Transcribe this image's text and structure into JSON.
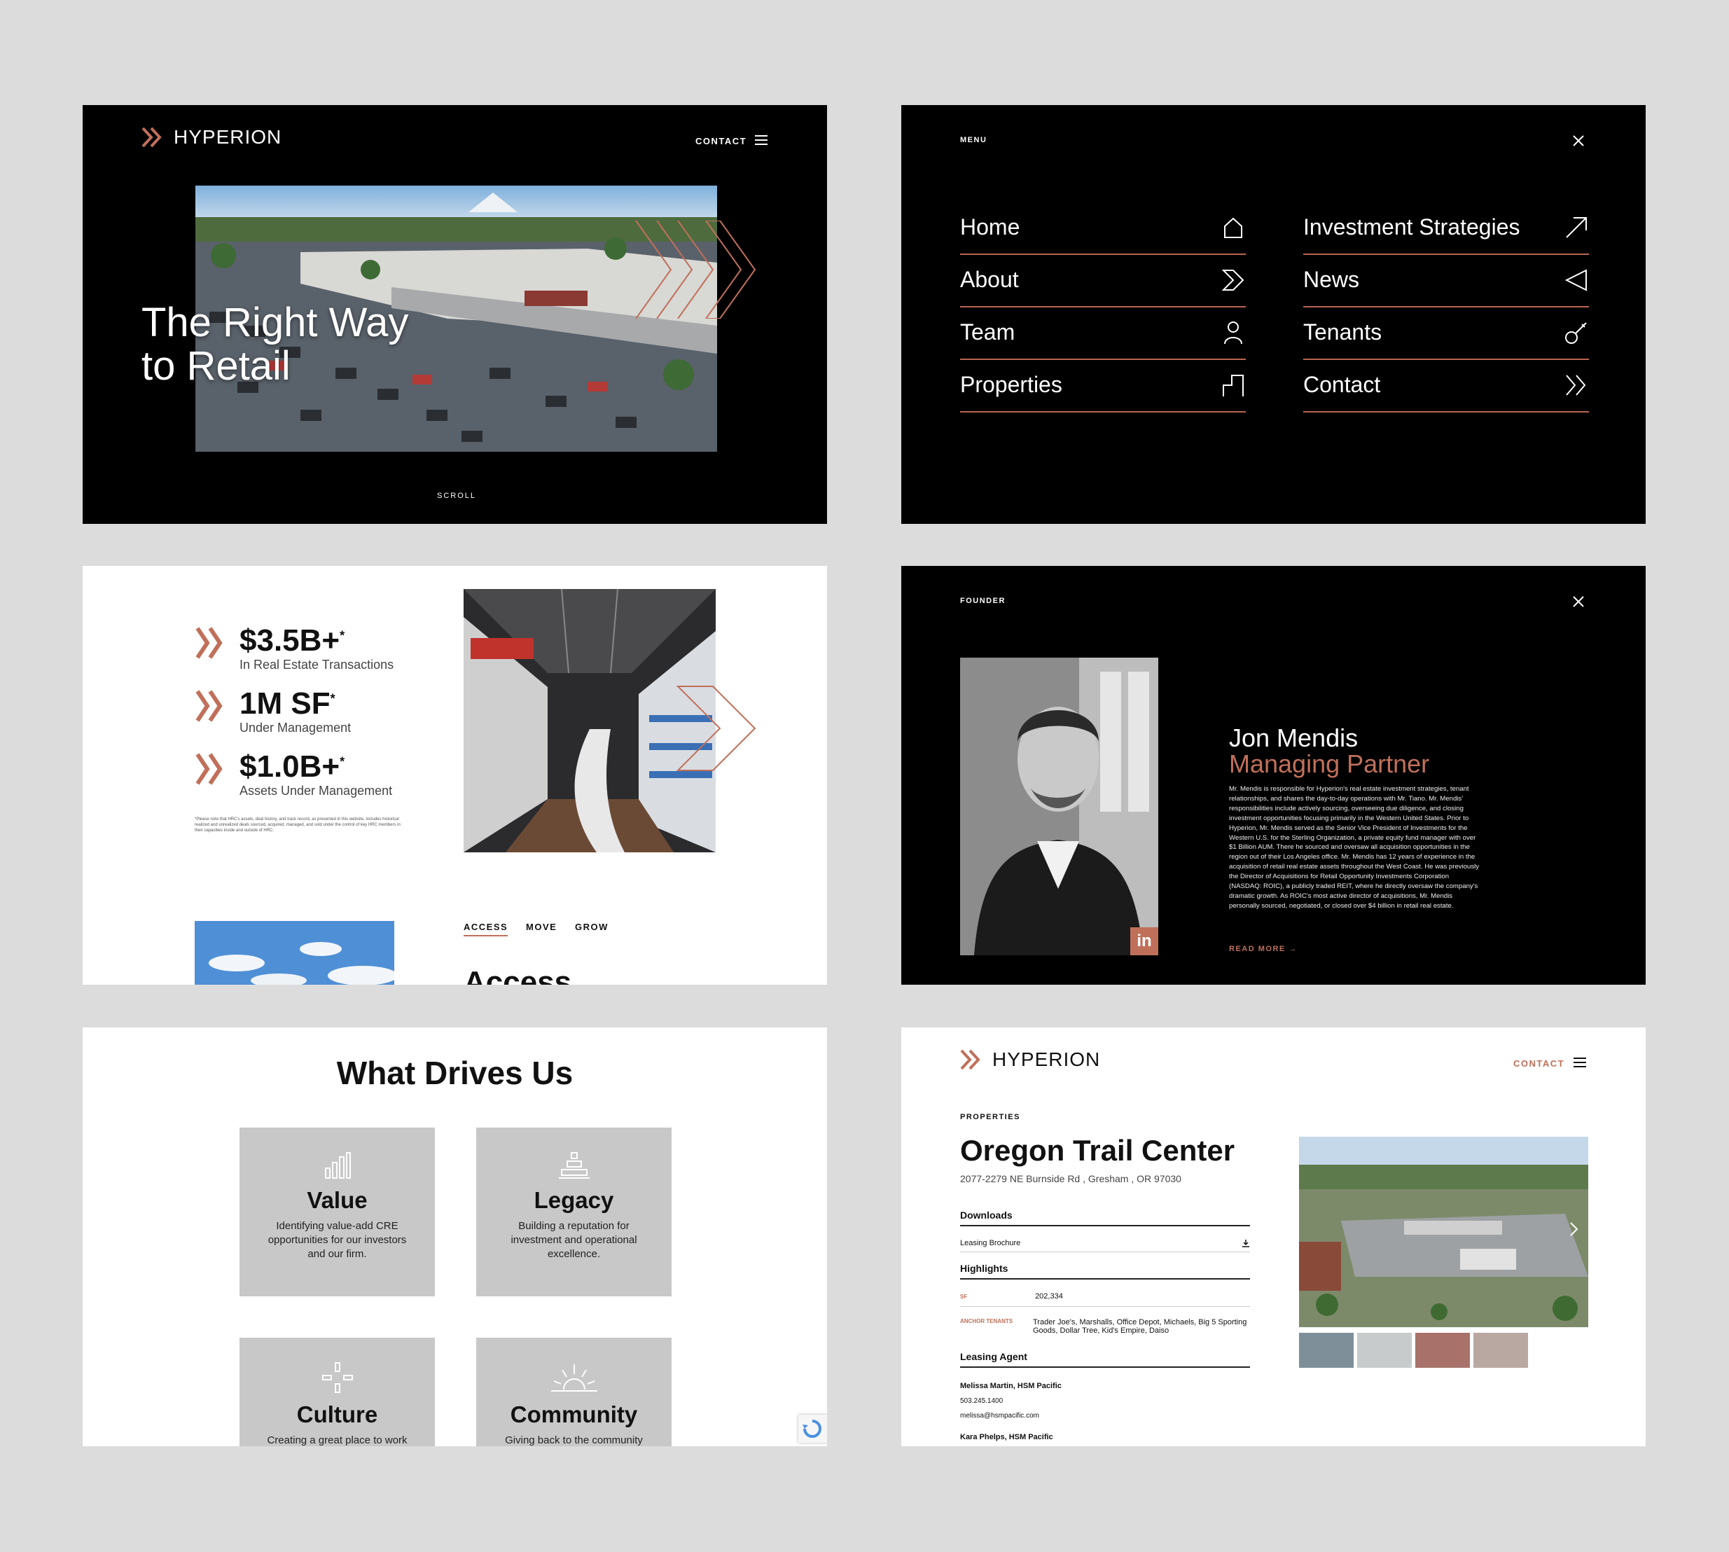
{
  "colors": {
    "accent": "#c0705a",
    "dark": "#000000",
    "card": "#c8c8c8",
    "bg": "#dcdcdc"
  },
  "hero": {
    "logo": "HYPERION",
    "contact": "CONTACT",
    "headline_line1": "The Right Way",
    "headline_line2": "to Retail",
    "scroll": "SCROLL"
  },
  "menu": {
    "label": "MENU",
    "left": [
      {
        "label": "Home",
        "icon": "home-icon"
      },
      {
        "label": "About",
        "icon": "chevron-right-icon"
      },
      {
        "label": "Team",
        "icon": "person-icon"
      },
      {
        "label": "Properties",
        "icon": "building-step-icon"
      }
    ],
    "right": [
      {
        "label": "Investment Strategies",
        "icon": "arrow-up-right-icon"
      },
      {
        "label": "News",
        "icon": "triangle-left-icon"
      },
      {
        "label": "Tenants",
        "icon": "key-icon"
      },
      {
        "label": "Contact",
        "icon": "double-chevron-icon"
      }
    ]
  },
  "stats": {
    "items": [
      {
        "value": "$3.5B+",
        "label": "In Real Estate Transactions"
      },
      {
        "value": "1M SF",
        "label": "Under Management"
      },
      {
        "value": "$1.0B+",
        "label": "Assets Under Management"
      }
    ],
    "asterisk": "*",
    "footnote": "*Please note that HRC's assets, deal history, and track record, as presented in this website, includes historical realized and unrealized deals sourced, acquired, managed, and sold under the control of key HRC members in their capacities inside and outside of HRC.",
    "tabs": [
      "ACCESS",
      "MOVE",
      "GROW"
    ],
    "section_heading": "Access"
  },
  "founder": {
    "label": "FOUNDER",
    "name": "Jon Mendis",
    "title": "Managing Partner",
    "linkedin": "in",
    "bio": "Mr. Mendis is responsible for Hyperion's real estate investment strategies, tenant relationships, and shares the day-to-day operations with Mr. Tiano. Mr. Mendis' responsibilities include actively sourcing, overseeing due diligence, and closing investment opportunities focusing primarily in the Western United States. Prior to Hyperion, Mr. Mendis served as the Senior Vice President of Investments for the Western U.S. for the Sterling Organization, a private equity fund manager with over $1 Billion AUM. There he sourced and oversaw all acquisition opportunities in the region out of their Los Angeles office. Mr. Mendis has 12 years of experience in the acquisition of retail real estate assets throughout the West Coast. He was previously the Director of Acquisitions for Retail Opportunity Investments Corporation (NASDAQ: ROIC), a publicly traded REIT, where he directly oversaw the company's dramatic growth. As ROIC's most active director of acquisitions, Mr. Mendis personally sourced, negotiated, or closed over $4 billion in retail real estate.",
    "read_more": "READ MORE →"
  },
  "drives": {
    "heading": "What Drives Us",
    "cards": [
      {
        "title": "Value",
        "desc": "Identifying value-add CRE opportunities for our investors and our firm.",
        "icon": "bar-chart-icon"
      },
      {
        "title": "Legacy",
        "desc": "Building a reputation for investment and operational excellence.",
        "icon": "pyramid-icon"
      },
      {
        "title": "Culture",
        "desc": "Creating a great place to work",
        "icon": "crosshair-icon"
      },
      {
        "title": "Community",
        "desc": "Giving back to the community",
        "icon": "sunrise-icon"
      }
    ]
  },
  "property": {
    "logo": "HYPERION",
    "contact": "CONTACT",
    "label": "PROPERTIES",
    "name": "Oregon Trail Center",
    "address": "2077-2279 NE Burnside Rd , Gresham , OR 97030",
    "downloads_h": "Downloads",
    "download_item": "Leasing Brochure",
    "highlights_h": "Highlights",
    "sf_label": "SF",
    "sf_value": "202,334",
    "anchor_label": "ANCHOR TENANTS",
    "anchor_value": "Trader Joe's, Marshalls, Office Depot, Michaels, Big 5 Sporting Goods, Dollar Tree, Kid's Empire, Daiso",
    "agent_h": "Leasing Agent",
    "agent1_name": "Melissa Martin, HSM Pacific",
    "agent1_phone": "503.245.1400",
    "agent1_email": "melissa@hsmpacific.com",
    "agent2_name": "Kara Phelps, HSM Pacific"
  }
}
